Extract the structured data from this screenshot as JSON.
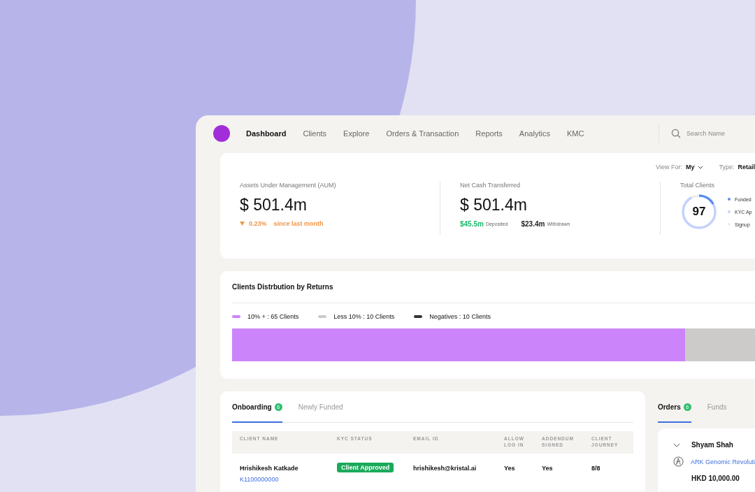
{
  "nav": {
    "items": [
      {
        "label": "Dashboard",
        "selected": true
      },
      {
        "label": "Clients",
        "selected": false
      },
      {
        "label": "Explore",
        "selected": false
      },
      {
        "label": "Orders & Transaction",
        "selected": false
      },
      {
        "label": "Reports",
        "selected": false
      },
      {
        "label": "Analytics",
        "selected": false
      },
      {
        "label": "KMC",
        "selected": false
      }
    ],
    "search": {
      "placeholder": "Search Name"
    }
  },
  "filters": [
    {
      "kind": "dropdown",
      "label": "View For:",
      "value": "My"
    },
    {
      "kind": "plain",
      "label": "Type:",
      "value": "Retail"
    }
  ],
  "stats": [
    {
      "kind": "aum",
      "title": "Assets Under Management (AUM)",
      "value": "$ 501.4m",
      "change": "0.23%",
      "change_note": "since last month"
    },
    {
      "kind": "cash",
      "title": "Net Cash Transferred",
      "value": "$ 501.4m",
      "deposited": "$45.5m",
      "deposited_label": "Deposited",
      "withdrawn": "$23.4m",
      "withdrawn_label": "Withdrawn"
    },
    {
      "kind": "clients",
      "title": "Total Clients",
      "value": "97",
      "legend": [
        {
          "label": "Funded",
          "color": "#5b8def",
          "level": 0.17
        },
        {
          "label": "KYC Ap",
          "color": "#c3d3fb",
          "level": 0.75
        },
        {
          "label": "Signup",
          "color": "#eeeeee",
          "level": 0.08
        }
      ]
    }
  ],
  "distribution": {
    "title": "Clients Distrbution by Returns",
    "legend": [
      {
        "label": "10% + : 65 Clients",
        "color": "#cc84fa",
        "level": 0.866
      },
      {
        "label": "Less 10% : 10 Clients",
        "color": "#cccbca",
        "level": 0.134
      },
      {
        "label": "Negatives : 10 Clients",
        "color": "#333333"
      }
    ]
  },
  "onboarding": {
    "tabs": [
      {
        "label": "Onboarding",
        "badge": "6",
        "selected": true
      },
      {
        "label": "Newly Funded",
        "selected": false
      }
    ],
    "columns": [
      "CLIENT NAME",
      "KYC STATUS",
      "EMAIL ID",
      "ALLOW LOG IN",
      "ADDENDUM SIGNED",
      "CLIENT JOURNEY"
    ],
    "rows": [
      {
        "name": "Hrishikesh Katkade",
        "id": "K1100000000",
        "kyc": "Client Approved",
        "email": "hrishikesh@kristal.ai",
        "allow_login": "Yes",
        "addendum": "Yes",
        "journey": "8/8"
      }
    ]
  },
  "orders": {
    "tabs": [
      {
        "label": "Orders",
        "badge": "6",
        "selected": true
      },
      {
        "label": "Funds",
        "selected": false
      }
    ],
    "card": {
      "client": "Shyam Shah",
      "fund": "ARK Genomic Revoluti",
      "amount": "HKD 10,000.00",
      "expanded": true
    }
  }
}
